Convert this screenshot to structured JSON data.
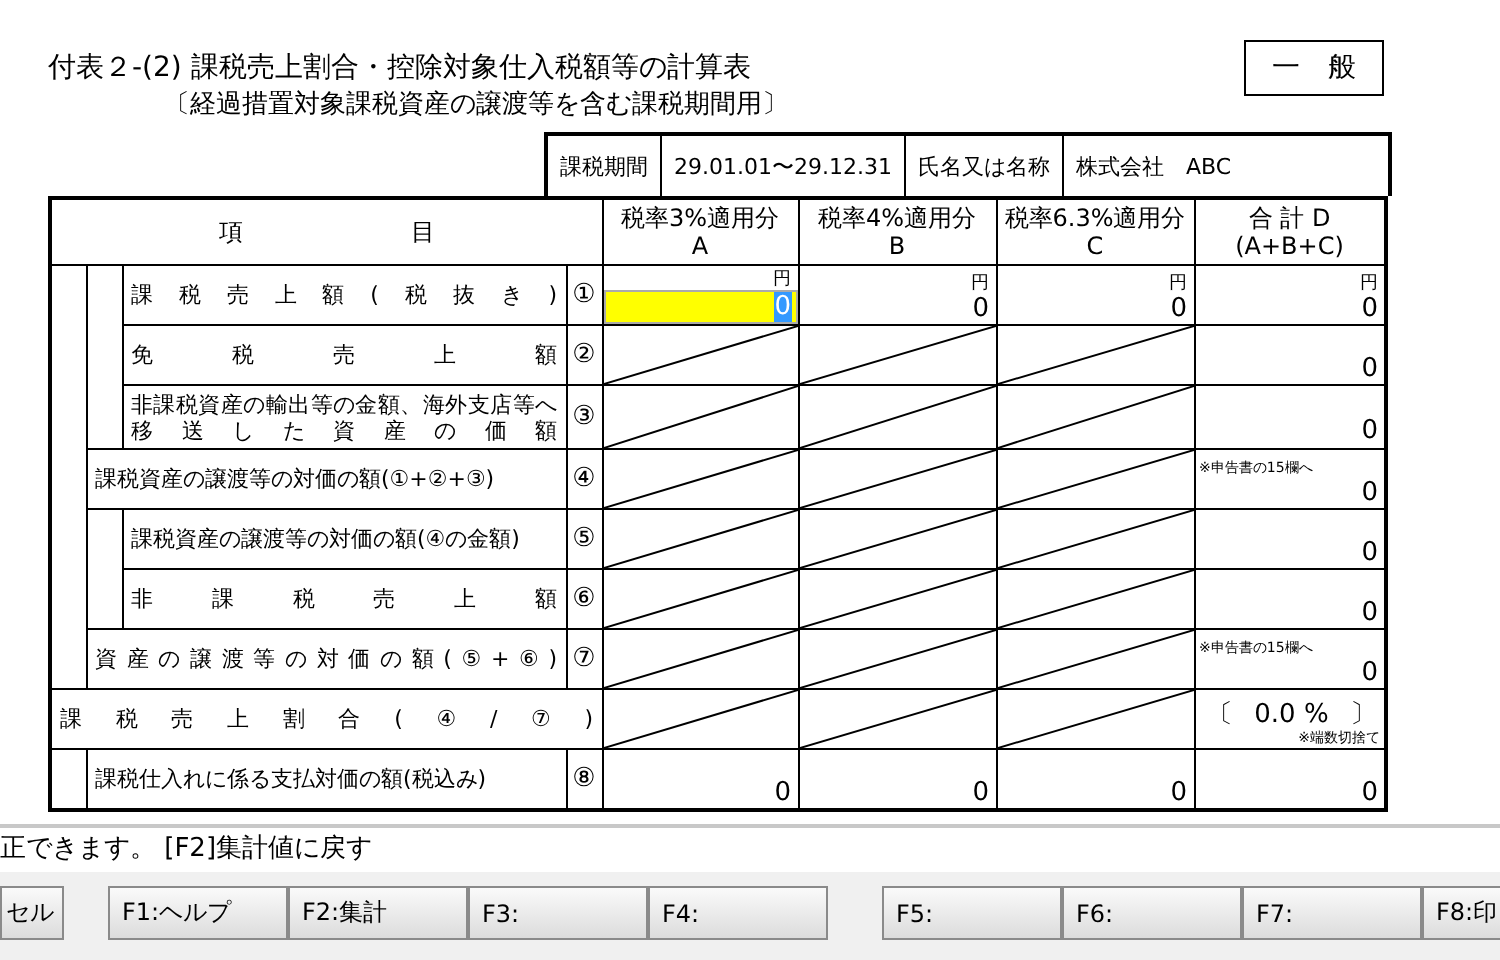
{
  "title": "付表２-(2) 課税売上割合・控除対象仕入税額等の計算表",
  "subtitle": "〔経過措置対象課税資産の譲渡等を含む課税期間用〕",
  "badge": "一　般",
  "info": [
    {
      "label": "課税期間",
      "value": "29.01.01〜29.12.31"
    },
    {
      "label": "氏名又は名称",
      "value": "株式会社　ABC"
    }
  ],
  "table": {
    "item_header": "項　　　　　　　目",
    "columns": [
      {
        "title": "税率3%適用分",
        "letter": "A"
      },
      {
        "title": "税率4%適用分",
        "letter": "B"
      },
      {
        "title": "税率6.3%適用分",
        "letter": "C"
      },
      {
        "title": "合 計 D",
        "letter": "(A+B+C)"
      }
    ],
    "rows": [
      {
        "kind": "group",
        "children": [
          {
            "label": "課税資産の譲渡等の対価の額(①+②+③)",
            "number": "④",
            "spread": false,
            "cells": [
              {
                "kind": "diagonal"
              },
              {
                "kind": "diagonal"
              },
              {
                "kind": "diagonal"
              },
              {
                "kind": "amount",
                "value": "0",
                "note": "※申告書の15欄へ"
              }
            ],
            "children": [
              {
                "label": "課税売上額(税抜き)",
                "number": "①",
                "spread": true,
                "cells": [
                  {
                    "kind": "input",
                    "value": "0",
                    "unit": "円",
                    "selected": true
                  },
                  {
                    "kind": "amount",
                    "value": "0",
                    "unit": "円"
                  },
                  {
                    "kind": "amount",
                    "value": "0",
                    "unit": "円"
                  },
                  {
                    "kind": "amount",
                    "value": "0",
                    "unit": "円"
                  }
                ]
              },
              {
                "label": "免税売上額",
                "number": "②",
                "spread": true,
                "cells": [
                  {
                    "kind": "diagonal"
                  },
                  {
                    "kind": "diagonal"
                  },
                  {
                    "kind": "diagonal"
                  },
                  {
                    "kind": "amount",
                    "value": "0"
                  }
                ]
              },
              {
                "label": "非課税資産の輸出等の金額、海外支店等へ移送した資産の価額",
                "number": "③",
                "spread": true,
                "cells": [
                  {
                    "kind": "diagonal"
                  },
                  {
                    "kind": "diagonal"
                  },
                  {
                    "kind": "diagonal"
                  },
                  {
                    "kind": "amount",
                    "value": "0"
                  }
                ]
              }
            ]
          },
          {
            "label": "資産の譲渡等の対価の額(⑤+⑥)",
            "number": "⑦",
            "spread": true,
            "cells": [
              {
                "kind": "diagonal"
              },
              {
                "kind": "diagonal"
              },
              {
                "kind": "diagonal"
              },
              {
                "kind": "amount",
                "value": "0",
                "note": "※申告書の15欄へ"
              }
            ],
            "children": [
              {
                "label": "課税資産の譲渡等の対価の額(④の金額)",
                "number": "⑤",
                "spread": false,
                "cells": [
                  {
                    "kind": "diagonal"
                  },
                  {
                    "kind": "diagonal"
                  },
                  {
                    "kind": "diagonal"
                  },
                  {
                    "kind": "amount",
                    "value": "0"
                  }
                ]
              },
              {
                "label": "非課税売上額",
                "number": "⑥",
                "spread": true,
                "cells": [
                  {
                    "kind": "diagonal"
                  },
                  {
                    "kind": "diagonal"
                  },
                  {
                    "kind": "diagonal"
                  },
                  {
                    "kind": "amount",
                    "value": "0"
                  }
                ]
              }
            ]
          }
        ]
      },
      {
        "label": "課税売上割合(④/⑦)",
        "spread": true,
        "cells": [
          {
            "kind": "diagonal"
          },
          {
            "kind": "diagonal"
          },
          {
            "kind": "diagonal"
          },
          {
            "kind": "ratio",
            "open": "〔",
            "value": "0.0 %",
            "close": "〕",
            "note": "※端数切捨て"
          }
        ]
      },
      {
        "kind": "group",
        "children": [
          {
            "label": "課税仕入れに係る支払対価の額(税込み)",
            "number": "⑧",
            "spread": false,
            "cells": [
              {
                "kind": "amount",
                "value": "0"
              },
              {
                "kind": "amount",
                "value": "0"
              },
              {
                "kind": "amount",
                "value": "0"
              },
              {
                "kind": "amount",
                "value": "0"
              }
            ]
          }
        ]
      }
    ]
  },
  "status_message": "正できます。 [F2]集計値に戻す",
  "key_groups": [
    [
      "セル"
    ],
    [
      "F1:ヘルプ",
      "F2:集計",
      "F3:",
      "F4:"
    ],
    [
      "F5:",
      "F6:",
      "F7:",
      "F8:印"
    ]
  ]
}
